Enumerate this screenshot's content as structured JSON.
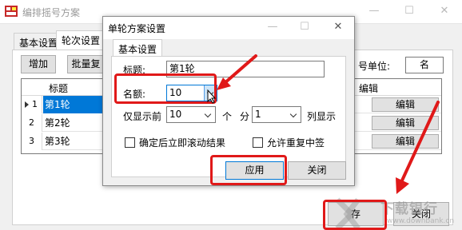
{
  "main_window": {
    "title": "编排摇号方案",
    "controls": {
      "minimize": "—",
      "maximize": "☐",
      "close": "✕"
    },
    "tabs": [
      "基本设置",
      "轮次设置"
    ],
    "toolbar": {
      "add_label": "增加",
      "batch_label": "批量复"
    },
    "unit_label": "号单位:",
    "unit_value": "名",
    "grid": {
      "headers": {
        "title": "标题",
        "edit": "编辑"
      },
      "rows": [
        {
          "num": "1",
          "title": "第1轮",
          "edit": "编辑"
        },
        {
          "num": "2",
          "title": "第2轮",
          "edit": "编辑"
        },
        {
          "num": "3",
          "title": "第3轮",
          "edit": "编辑"
        }
      ]
    },
    "footer": {
      "save_label": "存",
      "close_label": "关闭"
    }
  },
  "dialog": {
    "title": "单轮方案设置",
    "controls": {
      "minimize": "—",
      "maximize": "☐",
      "close": "✕"
    },
    "tab": "基本设置",
    "title_label": "标题:",
    "title_value": "第1轮",
    "quota_label": "名额:",
    "quota_value": "10",
    "show_label": "仅显示前",
    "show_value": "10",
    "unit_ge": "个",
    "unit_fen": "分",
    "columns_value": "1",
    "columns_label": "列显示",
    "check_autoscroll": "确定后立即滚动结果",
    "check_allow_repeat": "允许重复中签",
    "apply_label": "应用",
    "close_label": "关闭"
  },
  "watermark": {
    "brand": "下载银行",
    "url": "www.downbank.cn"
  },
  "colors": {
    "accent": "#0078d7",
    "annotation": "#e01919"
  }
}
